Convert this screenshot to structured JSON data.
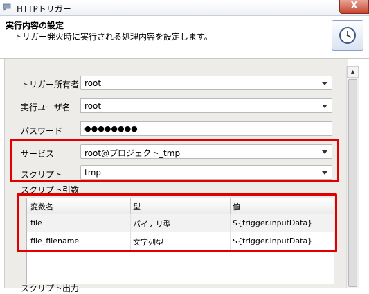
{
  "window": {
    "title": "HTTPトリガー",
    "close_label": "X"
  },
  "header": {
    "title": "実行内容の設定",
    "description": "トリガー発火時に実行される処理内容を設定します。"
  },
  "form": {
    "owner": {
      "label": "トリガー所有者",
      "value": "root"
    },
    "exec_user": {
      "label": "実行ユーザ名",
      "value": "root"
    },
    "password": {
      "label": "パスワード",
      "value": "●●●●●●●●"
    },
    "service": {
      "label": "サービス",
      "value": "root@プロジェクト_tmp"
    },
    "script": {
      "label": "スクリプト",
      "value": "tmp"
    },
    "script_args_label": "スクリプト引数",
    "script_output_label": "スクリプト出力"
  },
  "args_table": {
    "headers": [
      "変数名",
      "型",
      "値"
    ],
    "rows": [
      {
        "name": "file",
        "type": "バイナリ型",
        "value": "${trigger.inputData}"
      },
      {
        "name": "file_filename",
        "type": "文字列型",
        "value": "${trigger.inputData}"
      }
    ]
  },
  "colors": {
    "highlight": "#e00000",
    "panel": "#edece9"
  }
}
